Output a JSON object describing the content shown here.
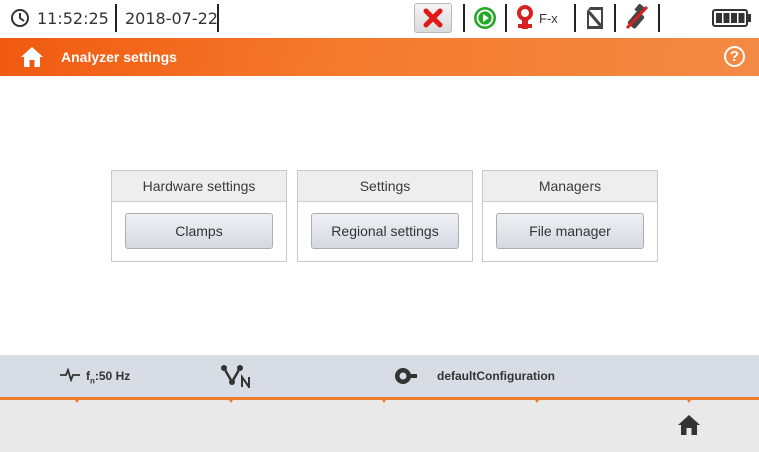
{
  "status": {
    "time": "11:52:25",
    "date": "2018-07-22",
    "flexible_clamp_label": "F-x"
  },
  "header": {
    "title": "Analyzer settings"
  },
  "groups": [
    {
      "title": "Hardware settings",
      "button": "Clamps"
    },
    {
      "title": "Settings",
      "button": "Regional settings"
    },
    {
      "title": "Managers",
      "button": "File manager"
    }
  ],
  "info": {
    "frequency_prefix": "f",
    "frequency_subscript": "n",
    "frequency_value": ":50 Hz",
    "config_name": "defaultConfiguration"
  },
  "colors": {
    "accent": "#f05a10",
    "stop": "#e01818",
    "run": "#22a822",
    "clamp": "#d82020"
  },
  "icons": {
    "clock": "clock-icon",
    "stop": "stop-measurement-icon",
    "run": "run-indicator-icon",
    "clamp": "clamp-icon",
    "sd_card": "sd-card-icon",
    "usb": "usb-icon",
    "battery": "battery-icon",
    "home": "home-icon",
    "help": "help-icon",
    "wave": "wave-icon",
    "network": "network-type-icon",
    "config": "configuration-icon"
  }
}
